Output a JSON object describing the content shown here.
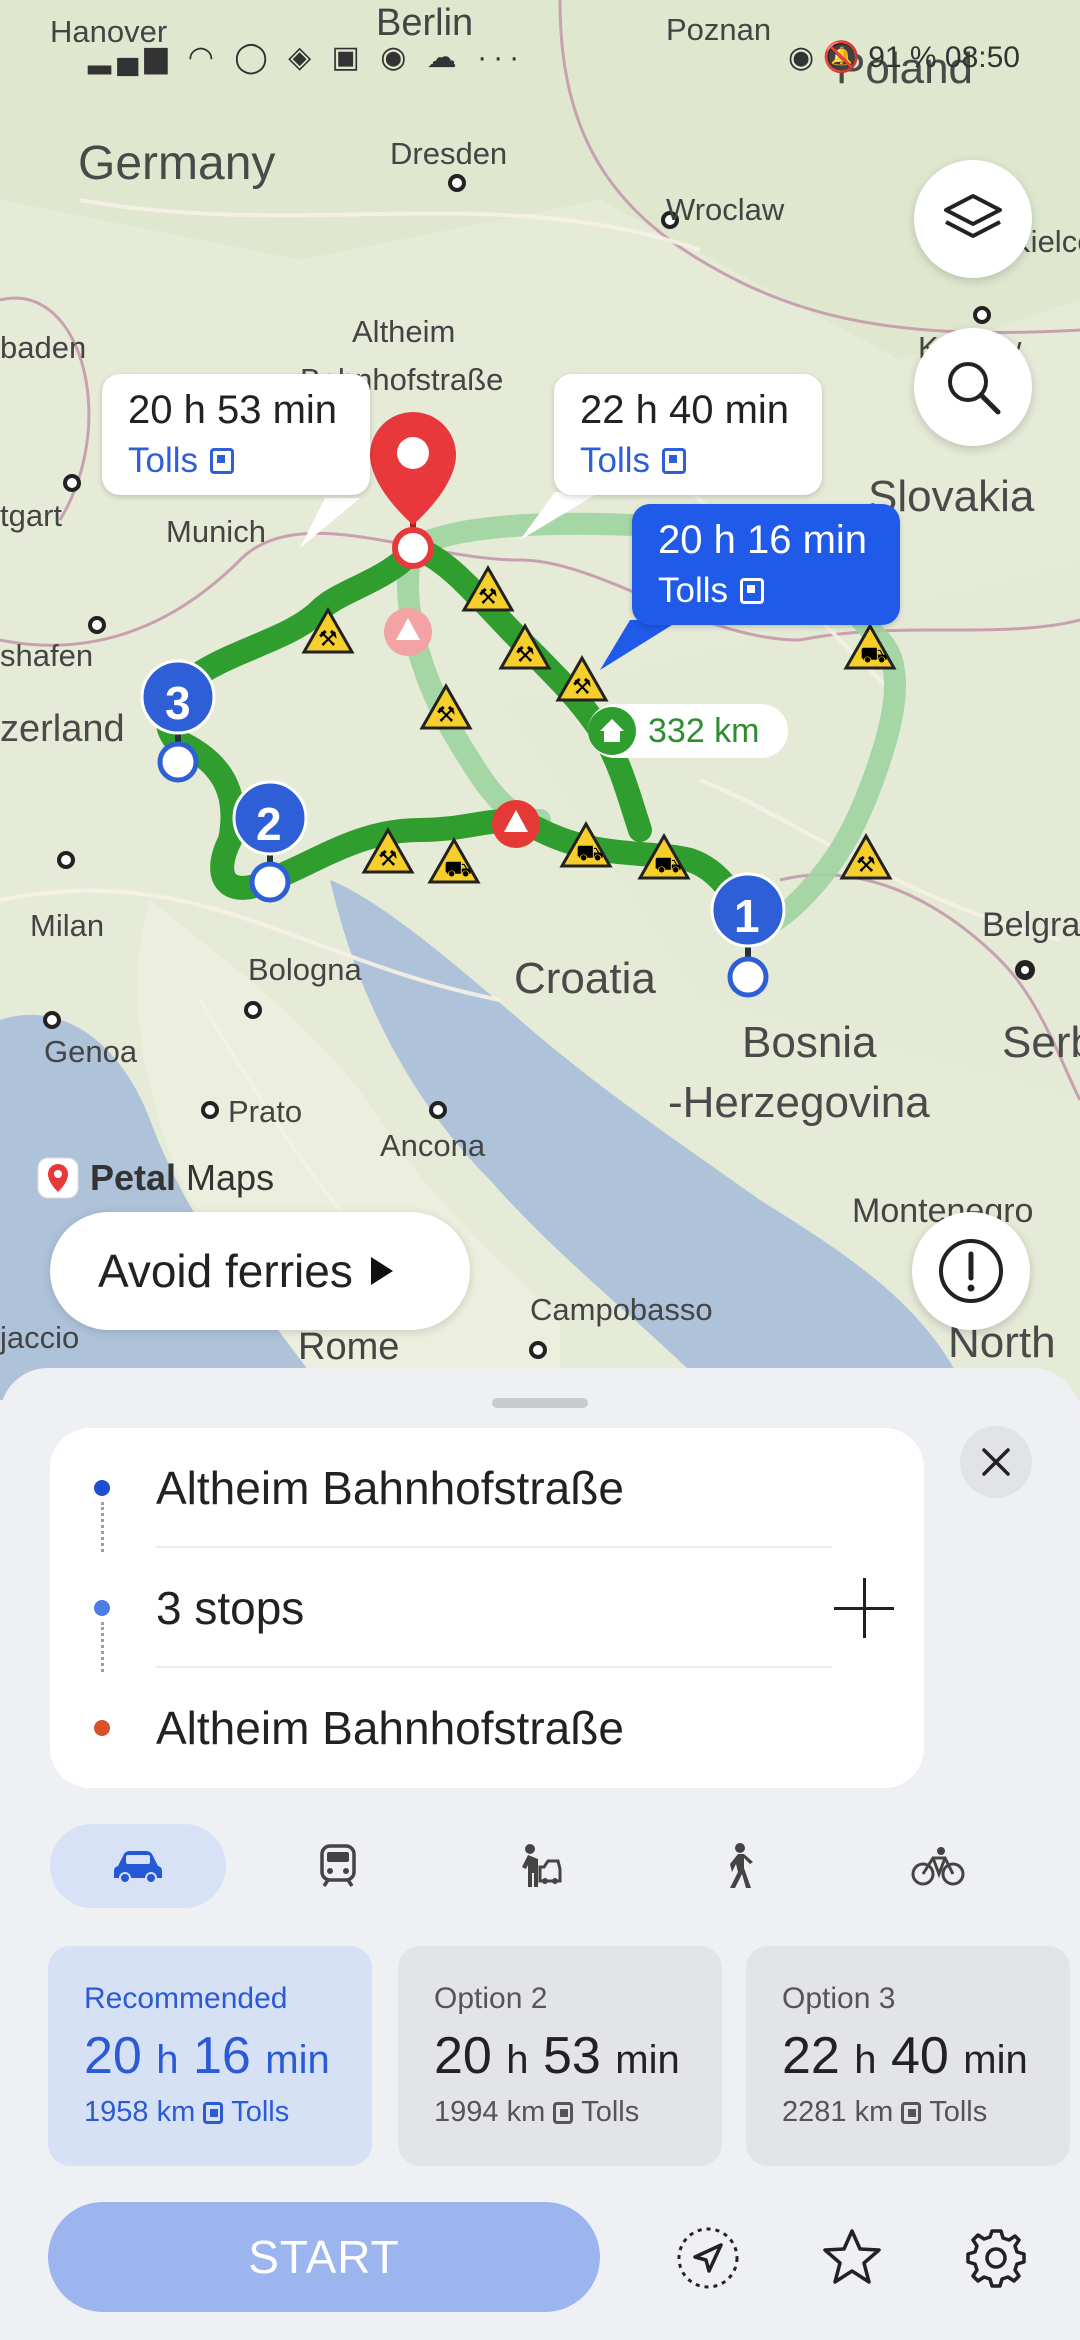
{
  "status_bar": {
    "battery": "91 %",
    "time": "08:50"
  },
  "map": {
    "labels": {
      "hanover": "Hanover",
      "berlin": "Berlin",
      "poznan": "Poznan",
      "poland": "Poland",
      "germany": "Germany",
      "dresden": "Dresden",
      "wroclaw": "Wroclaw",
      "kielce": "Kielce",
      "baden": "baden",
      "altheim": "Altheim",
      "bahnhofstrasse": "Bahnhofstraße",
      "krakow": "Krakow",
      "stuttgart": "tgart",
      "munich": "Munich",
      "slovakia": "Slovakia",
      "schafen": "shafen",
      "switzerland": "zerland",
      "milan": "Milan",
      "bologna": "Bologna",
      "croatia": "Croatia",
      "belgrade": "Belgrad",
      "genoa": "Genoa",
      "bosnia": "Bosnia",
      "herzegovina": "-Herzegovina",
      "serbia": "Serb",
      "prato": "Prato",
      "ancona": "Ancona",
      "montenegro": "Montenegro",
      "ajaccio": "jaccio",
      "campobasso": "Campobasso",
      "rome": "Rome",
      "north": "North"
    },
    "distance_badge": "332 km",
    "route_callouts": [
      {
        "time": "20 h 53 min",
        "tolls": "Tolls"
      },
      {
        "time": "22 h 40 min",
        "tolls": "Tolls"
      },
      {
        "time": "20 h 16 min",
        "tolls": "Tolls"
      }
    ],
    "stop_markers": [
      "1",
      "2",
      "3"
    ],
    "brand": {
      "petal": "Petal",
      "maps": "Maps"
    },
    "avoid_ferries": "Avoid ferries"
  },
  "route_panel": {
    "start": "Altheim Bahnhofstraße",
    "stops": "3 stops",
    "end": "Altheim Bahnhofstraße"
  },
  "travel_modes": [
    "car-icon",
    "transit-icon",
    "ride-hailing-icon",
    "walk-icon",
    "bike-icon"
  ],
  "options": [
    {
      "label": "Recommended",
      "hours": "20",
      "h": "h",
      "mins": "16",
      "min": "min",
      "distance": "1958 km",
      "tolls": "Tolls"
    },
    {
      "label": "Option 2",
      "hours": "20",
      "h": "h",
      "mins": "53",
      "min": "min",
      "distance": "1994 km",
      "tolls": "Tolls"
    },
    {
      "label": "Option 3",
      "hours": "22",
      "h": "h",
      "mins": "40",
      "min": "min",
      "distance": "2281 km",
      "tolls": "Tolls"
    }
  ],
  "start_button": "START",
  "colors": {
    "accent": "#1f5be8",
    "route_green": "#2f9e2f",
    "alt_route": "#9ad39c",
    "start_disabled": "#9db5ef"
  }
}
